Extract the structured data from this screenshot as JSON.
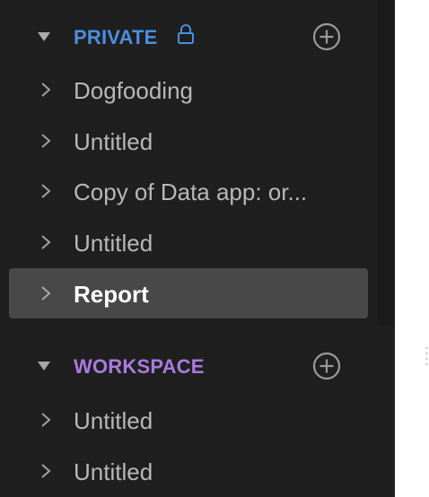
{
  "sections": {
    "private": {
      "title": "PRIVATE",
      "color": "#4a8fe0",
      "items": [
        {
          "label": "Dogfooding",
          "selected": false
        },
        {
          "label": "Untitled",
          "selected": false
        },
        {
          "label": "Copy of Data app: or...",
          "selected": false
        },
        {
          "label": "Untitled",
          "selected": false
        },
        {
          "label": "Report",
          "selected": true
        }
      ]
    },
    "workspace": {
      "title": "WORKSPACE",
      "color": "#a97be0",
      "items": [
        {
          "label": "Untitled",
          "selected": false
        },
        {
          "label": "Untitled",
          "selected": false
        }
      ]
    }
  },
  "icons": {
    "section_toggle": "caret-down-icon",
    "item_expand": "chevron-right-icon",
    "lock": "lock-icon",
    "add": "plus-circle-icon"
  }
}
